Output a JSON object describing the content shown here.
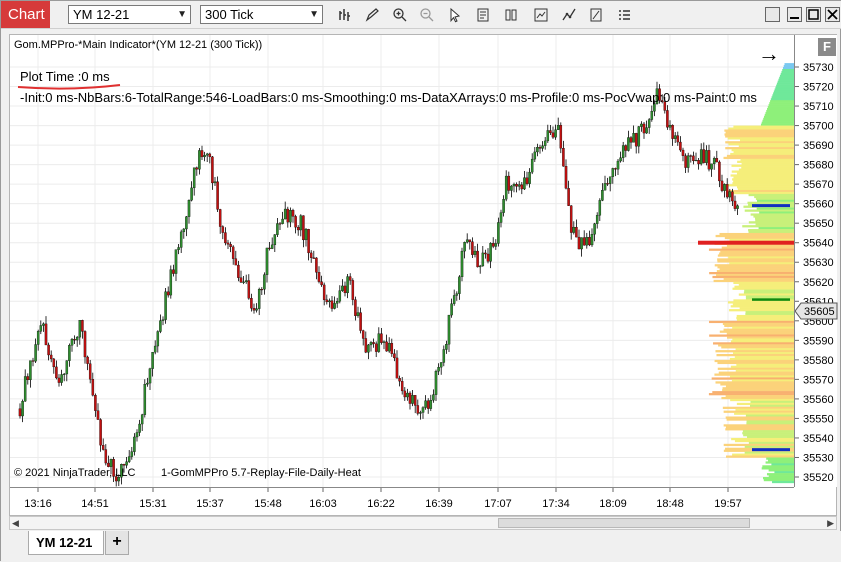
{
  "toolbar": {
    "chart_label": "Chart",
    "instrument": "YM 12-21",
    "interval": "300 Tick",
    "icons": [
      "bar-type-icon",
      "pencil-icon",
      "zoom-in-icon",
      "zoom-out-icon",
      "pointer-icon",
      "properties-icon",
      "strategy-icon",
      "indicator-icon",
      "drawing-tools-icon",
      "data-box-icon",
      "list-icon"
    ],
    "window_buttons": [
      "minimize",
      "maximize",
      "close"
    ]
  },
  "chart": {
    "indicator_title": "Gom.MPPro-*Main Indicator*(YM 12-21 (300 Tick))",
    "plot_time": "Plot Time :0 ms",
    "stats": "-Init:0 ms-NbBars:6-TotalRange:546-LoadBars:0 ms-Smoothing:0 ms-DataXArrays:0 ms-Profile:0 ms-PocVwap:0 ms-Paint:0 ms",
    "copyright": "© 2021 NinjaTrader, LLC",
    "strategy_label": "1-GomMPPro 5.7-Replay-File-Daily-Heat",
    "f_button": "F",
    "current_price": "35605",
    "price_labels": [
      "35730",
      "35720",
      "35710",
      "35700",
      "35690",
      "35680",
      "35670",
      "35660",
      "35650",
      "35640",
      "35630",
      "35620",
      "35610",
      "35600",
      "35590",
      "35580",
      "35570",
      "35560",
      "35550",
      "35540",
      "35530",
      "35520"
    ],
    "time_labels": [
      "13:16",
      "14:51",
      "15:31",
      "15:37",
      "15:48",
      "16:03",
      "16:22",
      "16:39",
      "17:07",
      "17:34",
      "18:09",
      "18:48",
      "19:57"
    ],
    "colors": {
      "up_candle": "#2e8b2e",
      "down_candle": "#c01010",
      "poc": "#e02020",
      "value_line": "#1030c0",
      "underline": "#e03030"
    }
  },
  "tabs": {
    "active": "YM 12-21",
    "add_label": "+"
  }
}
